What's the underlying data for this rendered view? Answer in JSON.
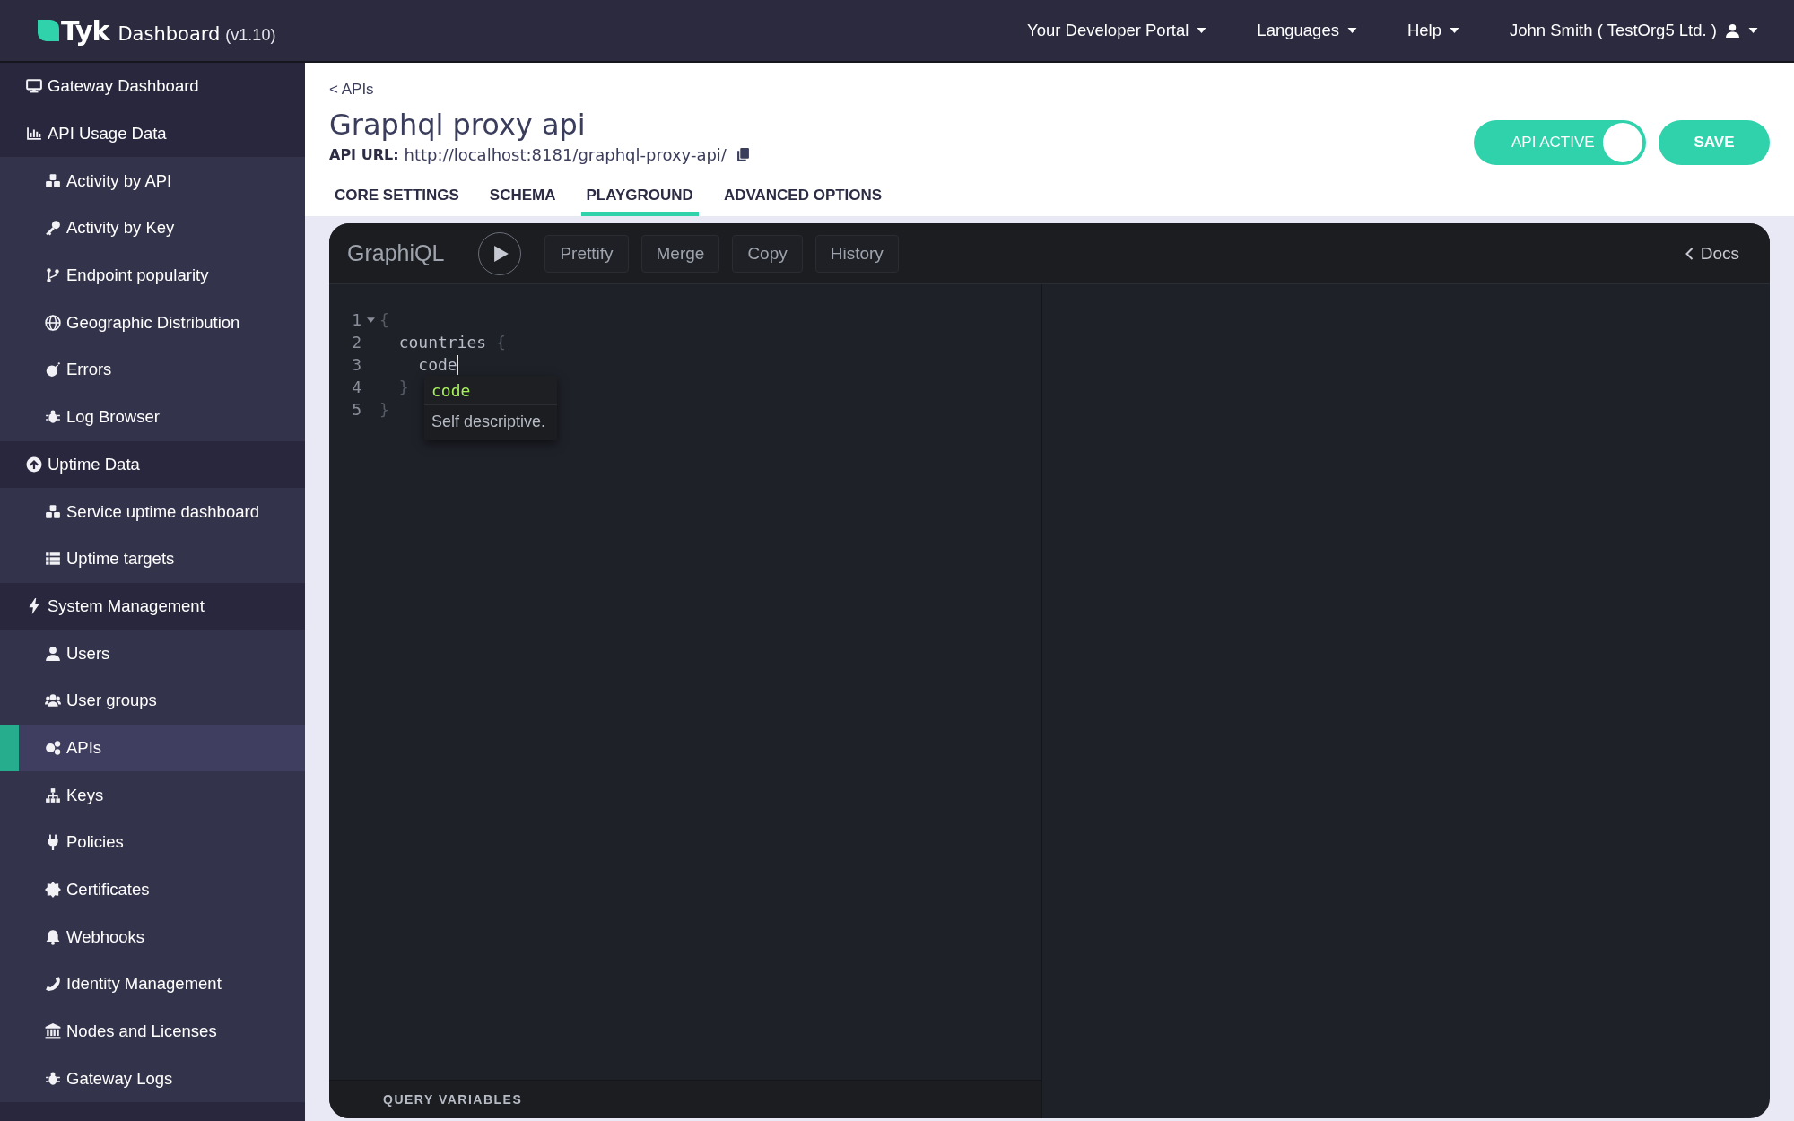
{
  "header": {
    "logo_text": "Tyk",
    "product": "Dashboard",
    "version": "(v1.10)",
    "menus": [
      {
        "label": "Your Developer Portal",
        "kind": "menu"
      },
      {
        "label": "Languages",
        "kind": "menu"
      },
      {
        "label": "Help",
        "kind": "menu"
      },
      {
        "label": "John Smith ( TestOrg5 Ltd. )",
        "kind": "user"
      }
    ]
  },
  "sidebar": {
    "items": [
      {
        "label": "Gateway Dashboard",
        "selected": false
      },
      {
        "label": "API Usage Data",
        "selected": false,
        "children": [
          {
            "label": "Activity by API",
            "selected": false
          },
          {
            "label": "Activity by Key",
            "selected": false
          },
          {
            "label": "Endpoint popularity",
            "selected": false
          },
          {
            "label": "Geographic Distribution",
            "selected": false
          },
          {
            "label": "Errors",
            "selected": false
          },
          {
            "label": "Log Browser",
            "selected": false
          }
        ]
      },
      {
        "label": "Uptime Data",
        "selected": false,
        "children": [
          {
            "label": "Service uptime dashboard",
            "selected": false
          },
          {
            "label": "Uptime targets",
            "selected": false
          }
        ]
      },
      {
        "label": "System Management",
        "selected": false,
        "children": [
          {
            "label": "Users",
            "selected": false
          },
          {
            "label": "User groups",
            "selected": false
          },
          {
            "label": "APIs",
            "selected": true
          },
          {
            "label": "Keys",
            "selected": false
          },
          {
            "label": "Policies",
            "selected": false
          },
          {
            "label": "Certificates",
            "selected": false
          },
          {
            "label": "Webhooks",
            "selected": false
          },
          {
            "label": "Identity Management",
            "selected": false
          },
          {
            "label": "Nodes and Licenses",
            "selected": false
          },
          {
            "label": "Gateway Logs",
            "selected": false
          }
        ]
      }
    ]
  },
  "page": {
    "breadcrumb": "< APIs",
    "title": "Graphql proxy api",
    "url_label": "API URL:",
    "url": "http://localhost:8181/graphql-proxy-api/",
    "status_toggle": {
      "label": "API ACTIVE",
      "on": true
    },
    "save_button": "SAVE",
    "tabs": [
      {
        "label": "CORE SETTINGS",
        "selected": false
      },
      {
        "label": "SCHEMA",
        "selected": false
      },
      {
        "label": "PLAYGROUND",
        "selected": true
      },
      {
        "label": "ADVANCED OPTIONS",
        "selected": false
      }
    ]
  },
  "graphiql": {
    "title": "GraphiQL",
    "buttons": [
      "Prettify",
      "Merge",
      "Copy",
      "History"
    ],
    "docs": "Docs",
    "lines": [
      {
        "number": "1",
        "foldable": true,
        "cursor": false,
        "tokens": [
          {
            "kind": "punct",
            "text": "{"
          }
        ]
      },
      {
        "number": "2",
        "foldable": false,
        "cursor": false,
        "tokens": [
          {
            "kind": "field",
            "text": "  countries"
          },
          {
            "kind": "punct",
            "text": " {"
          }
        ]
      },
      {
        "number": "3",
        "foldable": false,
        "cursor": true,
        "tokens": [
          {
            "kind": "field",
            "text": "    code"
          }
        ]
      },
      {
        "number": "4",
        "foldable": false,
        "cursor": false,
        "tokens": [
          {
            "kind": "punct",
            "text": "  }"
          }
        ]
      },
      {
        "number": "5",
        "foldable": false,
        "cursor": false,
        "tokens": [
          {
            "kind": "punct",
            "text": "}"
          }
        ]
      }
    ],
    "autocomplete": {
      "suggestions": [
        {
          "label": "code",
          "selected": true
        }
      ],
      "description": "Self descriptive."
    },
    "query_variables": "QUERY VARIABLES"
  }
}
